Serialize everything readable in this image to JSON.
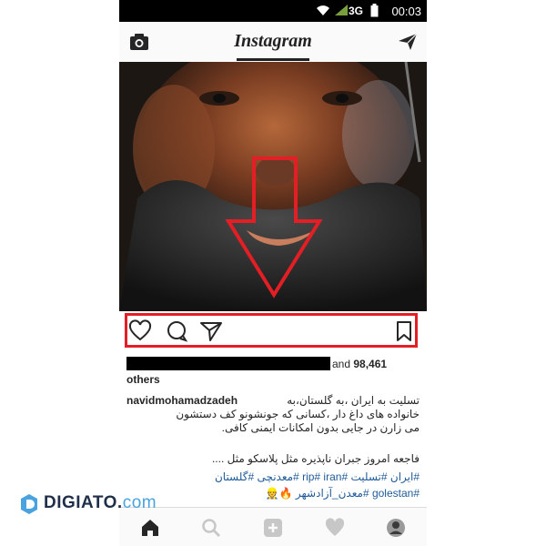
{
  "status_bar": {
    "network": "3G",
    "time": "00:03",
    "icons": [
      "wifi-icon",
      "signal-icon",
      "battery-icon"
    ]
  },
  "header": {
    "title": "Instagram",
    "left_icon": "camera-icon",
    "right_icon": "direct-send-icon"
  },
  "post": {
    "image_description_icon": "post-photo",
    "actions": {
      "icons": [
        "heart-icon",
        "comment-icon",
        "share-icon",
        "bookmark-icon"
      ],
      "highlight_color": "#e31e24"
    },
    "likes": {
      "prefix": "and",
      "count": "98,461",
      "suffix": "others"
    },
    "caption": {
      "username": "navidmohamadzadeh",
      "line1": "تسلیت به ایران ،به گلستان،به",
      "line2": "خانواده های داغ دار ،کسانی که جونشونو کف دستشون",
      "line3": "می زارن در جایی بدون امکانات ایمنی کافی.",
      "line4": "فاجعه امروز جبران ناپذیره مثل  پلاسکو مثل ....",
      "tags_line1": "#ایران #تسلیت #rip# iran #معدنچی #گلستان",
      "tags_line2": "#golestan #معدن_آزادشهر"
    }
  },
  "bottom_nav": {
    "icons": [
      "home-icon",
      "search-icon",
      "add-post-icon",
      "activity-heart-icon",
      "profile-avatar"
    ]
  },
  "watermark": {
    "brand": "DIGIATO",
    "dot": ".",
    "tld": "com",
    "brand_color": "#1f2f4a",
    "accent_color": "#4aa3df"
  }
}
